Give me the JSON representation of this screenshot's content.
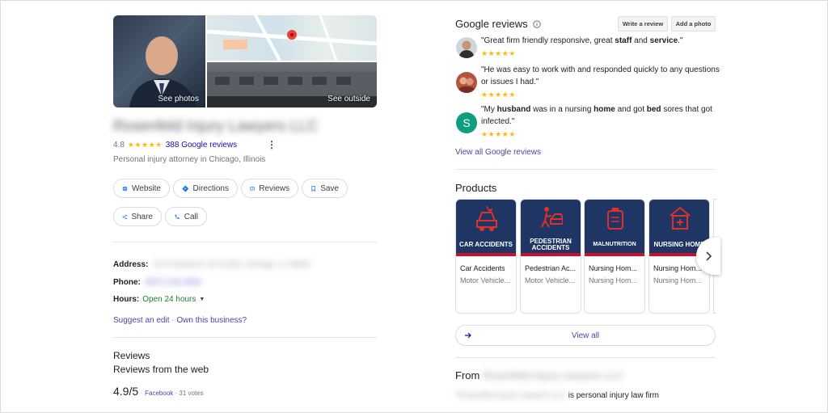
{
  "business": {
    "name": "Rosenfeld Injury Lawyers LLC",
    "rating": "4.8",
    "review_count_link": "388 Google reviews",
    "category": "Personal injury attorney in Chicago, Illinois",
    "photos": {
      "see_photos": "See photos",
      "see_outside": "See outside"
    }
  },
  "actions": {
    "website": "Website",
    "directions": "Directions",
    "reviews": "Reviews",
    "save": "Save",
    "share": "Share",
    "call": "Call"
  },
  "details": {
    "address_label": "Address:",
    "address_value": "33 N Dearborn St #1930, Chicago, IL 60602",
    "phone_label": "Phone:",
    "phone_value": "(847) 243-4693",
    "hours_label": "Hours:",
    "hours_value": "Open 24 hours",
    "suggest_edit": "Suggest an edit",
    "separator": " · ",
    "own_business": "Own this business?"
  },
  "web_reviews": {
    "heading": "Reviews",
    "subheading": "Reviews from the web",
    "score": "4.9/5",
    "source": "Facebook",
    "votes": " · 31 votes"
  },
  "google_reviews": {
    "title": "Google reviews",
    "write_review": "Write a review",
    "add_photo": "Add a photo",
    "items": [
      {
        "avatar_letter": "",
        "parts": [
          "\"Great firm friendly responsive, great ",
          "staff",
          " and ",
          "service",
          ".\""
        ],
        "stars": "★★★★★"
      },
      {
        "avatar_letter": "",
        "line1": "\"He was easy to work with and responded quickly to any questions",
        "line2": "or issues I had.\"",
        "stars": "★★★★★"
      },
      {
        "avatar_letter": "S",
        "parts": [
          "\"My ",
          "husband",
          " was in a nursing ",
          "home",
          " and got ",
          "bed",
          " sores that got"
        ],
        "line2": "infected.\"",
        "stars": "★★★★★"
      }
    ],
    "view_all": "View all Google reviews"
  },
  "products": {
    "title": "Products",
    "items": [
      {
        "banner": "CAR ACCIDENTS",
        "name": "Car Accidents",
        "category": "Motor Vehicle..."
      },
      {
        "banner": "PEDESTRIAN ACCIDENTS",
        "name": "Pedestrian Ac...",
        "category": "Motor Vehicle..."
      },
      {
        "banner": "MALNUTRITION",
        "name": "Nursing Hom...",
        "category": "Nursing Hom..."
      },
      {
        "banner": "NURSING HOME",
        "name": "Nursing Hom...",
        "category": "Nursing Hom..."
      }
    ],
    "view_all": "View all"
  },
  "from": {
    "label": "From",
    "name": "Rosenfeld Injury Lawyers LLC",
    "quote_blurred": "\"Rosenfeld Injury Lawyers LLC",
    "quote_rest": "is personal injury law firm"
  },
  "colors": {
    "accent_blue": "#1a73e8",
    "star": "#fbbc04",
    "open_green": "#188038",
    "banner_navy": "#1f3563",
    "banner_red": "#c8102e"
  }
}
